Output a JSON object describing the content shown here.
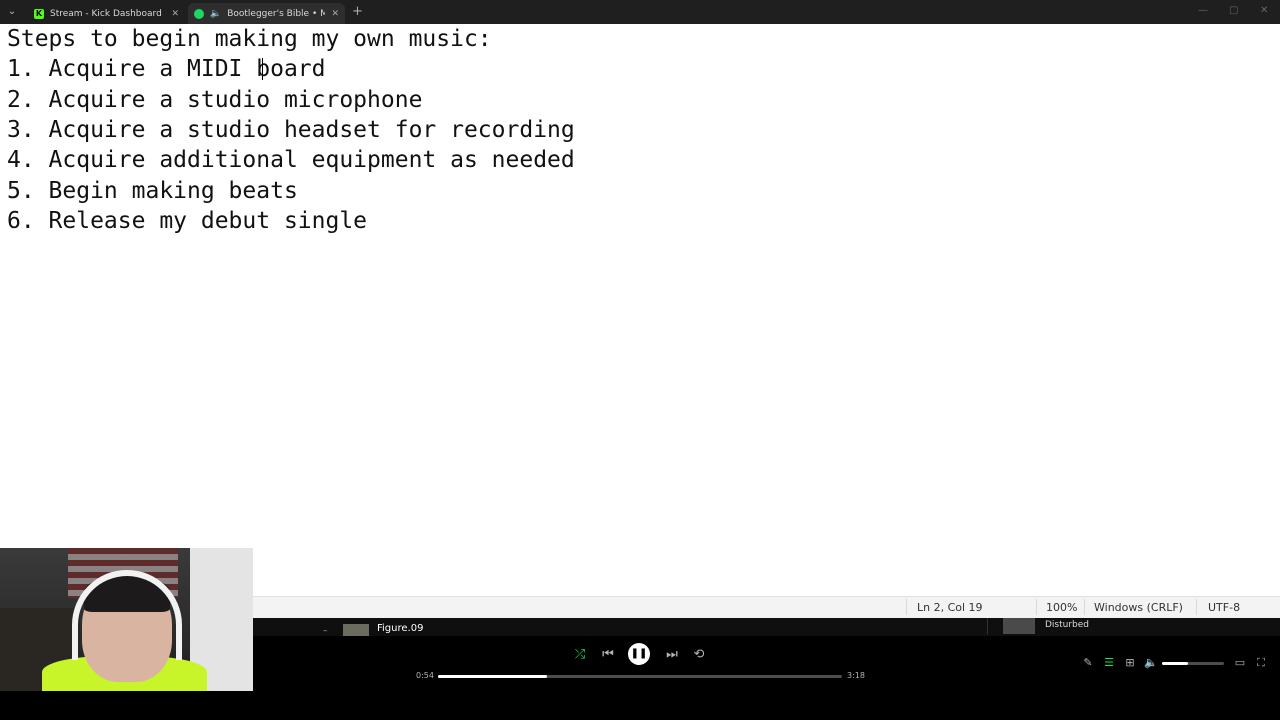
{
  "browser": {
    "tabs": [
      {
        "title": "Stream - Kick Dashboard",
        "favicon": "kick-icon"
      },
      {
        "title": "Bootlegger's Bible • Mary Kut",
        "favicon": "spotify-icon",
        "audio": true
      }
    ]
  },
  "editor": {
    "lines": [
      "Steps to begin making my own music:",
      "1. Acquire a MIDI board",
      "2. Acquire a studio microphone",
      "3. Acquire a studio headset for recording",
      "4. Acquire additional equipment as needed",
      "5. Begin making beats",
      "6. Release my debut single"
    ]
  },
  "statusbar": {
    "position": "Ln 2, Col 19",
    "zoom": "100%",
    "line_endings": "Windows (CRLF)",
    "encoding": "UTF-8"
  },
  "player": {
    "prev_track_title": "Figure.09",
    "next_artist": "Disturbed",
    "elapsed": "0:54",
    "duration": "3:18",
    "progress_fraction": 0.27,
    "volume_fraction": 0.42,
    "shuffle_on": true,
    "accent_color": "#1ed760"
  }
}
